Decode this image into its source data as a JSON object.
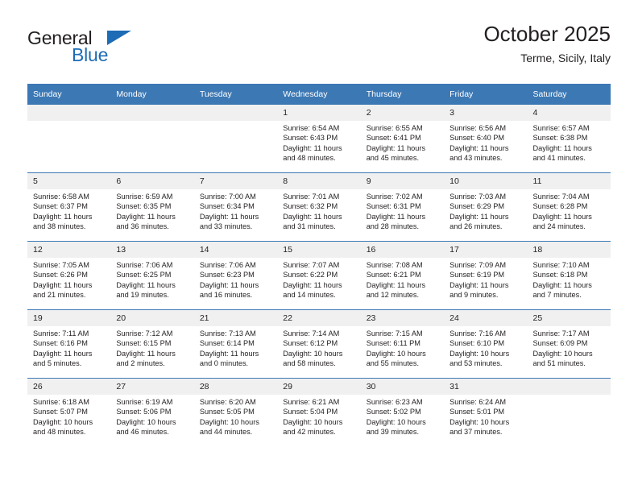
{
  "brand": {
    "line1": "General",
    "line2": "Blue",
    "triangle_color": "#1e6cb5",
    "text_color": "#231f20"
  },
  "header": {
    "title": "October 2025",
    "subtitle": "Terme, Sicily, Italy"
  },
  "theme": {
    "header_blue": "#3c78b4",
    "daynum_bg": "#f0f0f0",
    "text": "#231f20"
  },
  "weekdays": [
    "Sunday",
    "Monday",
    "Tuesday",
    "Wednesday",
    "Thursday",
    "Friday",
    "Saturday"
  ],
  "weeks": [
    [
      {
        "day": "",
        "sunrise": "",
        "sunset": "",
        "daylight1": "",
        "daylight2": ""
      },
      {
        "day": "",
        "sunrise": "",
        "sunset": "",
        "daylight1": "",
        "daylight2": ""
      },
      {
        "day": "",
        "sunrise": "",
        "sunset": "",
        "daylight1": "",
        "daylight2": ""
      },
      {
        "day": "1",
        "sunrise": "Sunrise: 6:54 AM",
        "sunset": "Sunset: 6:43 PM",
        "daylight1": "Daylight: 11 hours",
        "daylight2": "and 48 minutes."
      },
      {
        "day": "2",
        "sunrise": "Sunrise: 6:55 AM",
        "sunset": "Sunset: 6:41 PM",
        "daylight1": "Daylight: 11 hours",
        "daylight2": "and 45 minutes."
      },
      {
        "day": "3",
        "sunrise": "Sunrise: 6:56 AM",
        "sunset": "Sunset: 6:40 PM",
        "daylight1": "Daylight: 11 hours",
        "daylight2": "and 43 minutes."
      },
      {
        "day": "4",
        "sunrise": "Sunrise: 6:57 AM",
        "sunset": "Sunset: 6:38 PM",
        "daylight1": "Daylight: 11 hours",
        "daylight2": "and 41 minutes."
      }
    ],
    [
      {
        "day": "5",
        "sunrise": "Sunrise: 6:58 AM",
        "sunset": "Sunset: 6:37 PM",
        "daylight1": "Daylight: 11 hours",
        "daylight2": "and 38 minutes."
      },
      {
        "day": "6",
        "sunrise": "Sunrise: 6:59 AM",
        "sunset": "Sunset: 6:35 PM",
        "daylight1": "Daylight: 11 hours",
        "daylight2": "and 36 minutes."
      },
      {
        "day": "7",
        "sunrise": "Sunrise: 7:00 AM",
        "sunset": "Sunset: 6:34 PM",
        "daylight1": "Daylight: 11 hours",
        "daylight2": "and 33 minutes."
      },
      {
        "day": "8",
        "sunrise": "Sunrise: 7:01 AM",
        "sunset": "Sunset: 6:32 PM",
        "daylight1": "Daylight: 11 hours",
        "daylight2": "and 31 minutes."
      },
      {
        "day": "9",
        "sunrise": "Sunrise: 7:02 AM",
        "sunset": "Sunset: 6:31 PM",
        "daylight1": "Daylight: 11 hours",
        "daylight2": "and 28 minutes."
      },
      {
        "day": "10",
        "sunrise": "Sunrise: 7:03 AM",
        "sunset": "Sunset: 6:29 PM",
        "daylight1": "Daylight: 11 hours",
        "daylight2": "and 26 minutes."
      },
      {
        "day": "11",
        "sunrise": "Sunrise: 7:04 AM",
        "sunset": "Sunset: 6:28 PM",
        "daylight1": "Daylight: 11 hours",
        "daylight2": "and 24 minutes."
      }
    ],
    [
      {
        "day": "12",
        "sunrise": "Sunrise: 7:05 AM",
        "sunset": "Sunset: 6:26 PM",
        "daylight1": "Daylight: 11 hours",
        "daylight2": "and 21 minutes."
      },
      {
        "day": "13",
        "sunrise": "Sunrise: 7:06 AM",
        "sunset": "Sunset: 6:25 PM",
        "daylight1": "Daylight: 11 hours",
        "daylight2": "and 19 minutes."
      },
      {
        "day": "14",
        "sunrise": "Sunrise: 7:06 AM",
        "sunset": "Sunset: 6:23 PM",
        "daylight1": "Daylight: 11 hours",
        "daylight2": "and 16 minutes."
      },
      {
        "day": "15",
        "sunrise": "Sunrise: 7:07 AM",
        "sunset": "Sunset: 6:22 PM",
        "daylight1": "Daylight: 11 hours",
        "daylight2": "and 14 minutes."
      },
      {
        "day": "16",
        "sunrise": "Sunrise: 7:08 AM",
        "sunset": "Sunset: 6:21 PM",
        "daylight1": "Daylight: 11 hours",
        "daylight2": "and 12 minutes."
      },
      {
        "day": "17",
        "sunrise": "Sunrise: 7:09 AM",
        "sunset": "Sunset: 6:19 PM",
        "daylight1": "Daylight: 11 hours",
        "daylight2": "and 9 minutes."
      },
      {
        "day": "18",
        "sunrise": "Sunrise: 7:10 AM",
        "sunset": "Sunset: 6:18 PM",
        "daylight1": "Daylight: 11 hours",
        "daylight2": "and 7 minutes."
      }
    ],
    [
      {
        "day": "19",
        "sunrise": "Sunrise: 7:11 AM",
        "sunset": "Sunset: 6:16 PM",
        "daylight1": "Daylight: 11 hours",
        "daylight2": "and 5 minutes."
      },
      {
        "day": "20",
        "sunrise": "Sunrise: 7:12 AM",
        "sunset": "Sunset: 6:15 PM",
        "daylight1": "Daylight: 11 hours",
        "daylight2": "and 2 minutes."
      },
      {
        "day": "21",
        "sunrise": "Sunrise: 7:13 AM",
        "sunset": "Sunset: 6:14 PM",
        "daylight1": "Daylight: 11 hours",
        "daylight2": "and 0 minutes."
      },
      {
        "day": "22",
        "sunrise": "Sunrise: 7:14 AM",
        "sunset": "Sunset: 6:12 PM",
        "daylight1": "Daylight: 10 hours",
        "daylight2": "and 58 minutes."
      },
      {
        "day": "23",
        "sunrise": "Sunrise: 7:15 AM",
        "sunset": "Sunset: 6:11 PM",
        "daylight1": "Daylight: 10 hours",
        "daylight2": "and 55 minutes."
      },
      {
        "day": "24",
        "sunrise": "Sunrise: 7:16 AM",
        "sunset": "Sunset: 6:10 PM",
        "daylight1": "Daylight: 10 hours",
        "daylight2": "and 53 minutes."
      },
      {
        "day": "25",
        "sunrise": "Sunrise: 7:17 AM",
        "sunset": "Sunset: 6:09 PM",
        "daylight1": "Daylight: 10 hours",
        "daylight2": "and 51 minutes."
      }
    ],
    [
      {
        "day": "26",
        "sunrise": "Sunrise: 6:18 AM",
        "sunset": "Sunset: 5:07 PM",
        "daylight1": "Daylight: 10 hours",
        "daylight2": "and 48 minutes."
      },
      {
        "day": "27",
        "sunrise": "Sunrise: 6:19 AM",
        "sunset": "Sunset: 5:06 PM",
        "daylight1": "Daylight: 10 hours",
        "daylight2": "and 46 minutes."
      },
      {
        "day": "28",
        "sunrise": "Sunrise: 6:20 AM",
        "sunset": "Sunset: 5:05 PM",
        "daylight1": "Daylight: 10 hours",
        "daylight2": "and 44 minutes."
      },
      {
        "day": "29",
        "sunrise": "Sunrise: 6:21 AM",
        "sunset": "Sunset: 5:04 PM",
        "daylight1": "Daylight: 10 hours",
        "daylight2": "and 42 minutes."
      },
      {
        "day": "30",
        "sunrise": "Sunrise: 6:23 AM",
        "sunset": "Sunset: 5:02 PM",
        "daylight1": "Daylight: 10 hours",
        "daylight2": "and 39 minutes."
      },
      {
        "day": "31",
        "sunrise": "Sunrise: 6:24 AM",
        "sunset": "Sunset: 5:01 PM",
        "daylight1": "Daylight: 10 hours",
        "daylight2": "and 37 minutes."
      },
      {
        "day": "",
        "sunrise": "",
        "sunset": "",
        "daylight1": "",
        "daylight2": ""
      }
    ]
  ]
}
